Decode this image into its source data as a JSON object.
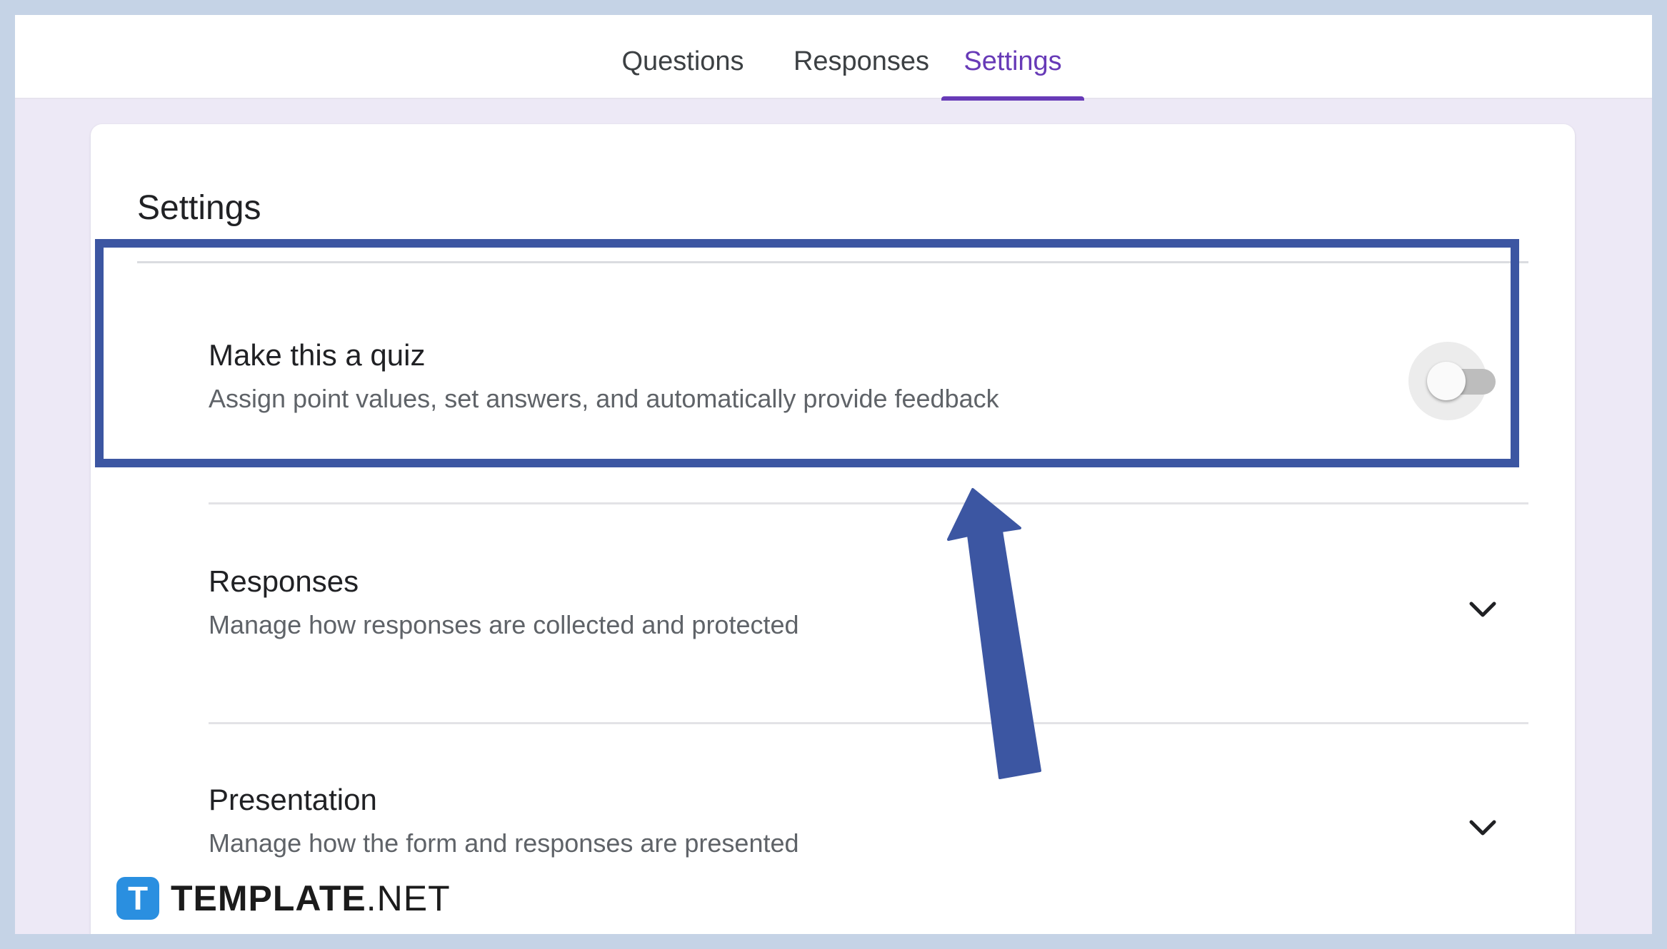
{
  "tabs": [
    {
      "label": "Questions",
      "active": false
    },
    {
      "label": "Responses",
      "active": false
    },
    {
      "label": "Settings",
      "active": true
    }
  ],
  "settings": {
    "title": "Settings",
    "rows": [
      {
        "title": "Make this a quiz",
        "description": "Assign point values, set answers, and automatically provide feedback",
        "control": "toggle",
        "enabled": false
      },
      {
        "title": "Responses",
        "description": "Manage how responses are collected and protected",
        "control": "chevron-down-icon"
      },
      {
        "title": "Presentation",
        "description": "Manage how the form and responses are presented",
        "control": "chevron-down-icon"
      }
    ]
  },
  "annotation": {
    "box_color": "#3c56a2",
    "arrow_color": "#3c56a2"
  },
  "colors": {
    "accent": "#673ab7",
    "background": "#ede9f6",
    "outer_frame": "#c5d3e6"
  },
  "watermark": {
    "logo_letter": "T",
    "brand_bold": "TEMPLATE",
    "brand_suffix": ".NET"
  }
}
